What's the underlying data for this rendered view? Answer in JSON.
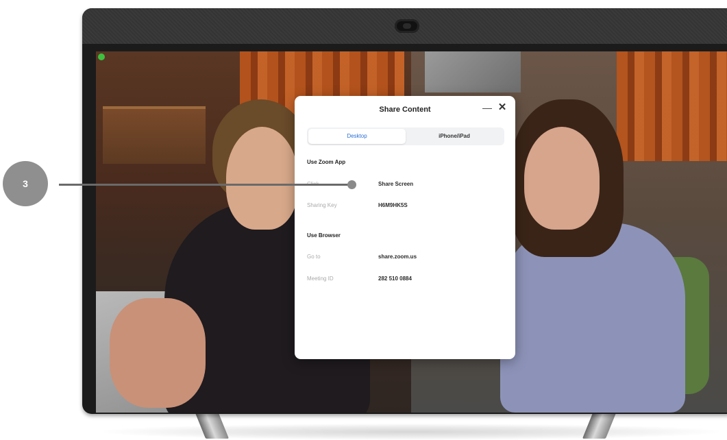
{
  "callout": {
    "number": "3"
  },
  "dialog": {
    "title": "Share Content",
    "minimize_icon": "minimize-icon",
    "close_icon": "close-icon",
    "tabs": [
      {
        "label": "Desktop",
        "active": true
      },
      {
        "label": "iPhone/iPad",
        "active": false
      }
    ],
    "sections": [
      {
        "heading": "Use Zoom App",
        "rows": [
          {
            "key": "Click",
            "value": "Share Screen"
          },
          {
            "key": "Sharing Key",
            "value": "H6M9HK5S"
          }
        ]
      },
      {
        "heading": "Use Browser",
        "rows": [
          {
            "key": "Go to",
            "value": "share.zoom.us"
          },
          {
            "key": "Meeting ID",
            "value": "282 510 0884"
          }
        ]
      }
    ]
  },
  "colors": {
    "accent": "#2a6fd6",
    "callout": "#8f8f8f",
    "status_dot": "#3fbf3f"
  }
}
